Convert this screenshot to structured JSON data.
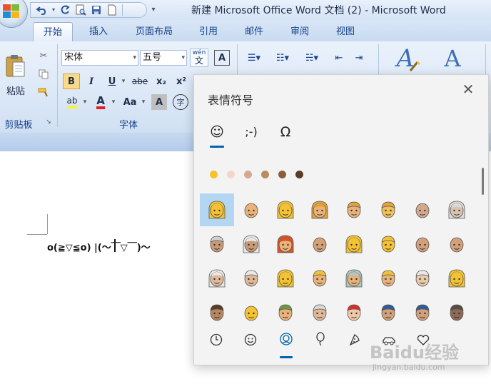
{
  "window": {
    "title": "新建 Microsoft Office Word 文档 (2) - Microsoft Word"
  },
  "quick_access": {
    "undo_icon": "undo-icon",
    "redo_icon": "redo-icon",
    "print_preview_icon": "print-preview-icon",
    "save_icon": "save-icon",
    "new_icon": "new-document-icon",
    "customize_glyph": "▾"
  },
  "tabs": [
    {
      "label": "开始",
      "active": true
    },
    {
      "label": "插入"
    },
    {
      "label": "页面布局"
    },
    {
      "label": "引用"
    },
    {
      "label": "邮件"
    },
    {
      "label": "审阅"
    },
    {
      "label": "视图"
    }
  ],
  "ribbon": {
    "clipboard": {
      "paste_label": "粘贴",
      "group_label": "剪贴板"
    },
    "font": {
      "font_name": "宋体",
      "font_size": "五号",
      "wen_glyph": "wén",
      "wen_char": "文",
      "char_border_glyph": "A",
      "bold": "B",
      "italic": "I",
      "underline": "U",
      "strike": "abe",
      "subscript": "x₂",
      "superscript": "x²",
      "highlight_glyph": "ab",
      "font_color_glyph": "A",
      "change_case": "Aa",
      "char_shading_glyph": "A",
      "enclose_glyph": "字",
      "group_label": "字体"
    },
    "styles": {
      "style_glyph_1": "A",
      "style_glyph_2": "A"
    }
  },
  "document": {
    "text": "o(≧▽≦o) |(～￣▽￣)～"
  },
  "emoji_panel": {
    "title": "表情符号",
    "close_glyph": "✕",
    "categories": [
      {
        "glyph": "☺",
        "name": "emoji"
      },
      {
        "glyph": ";-)",
        "name": "kaomoji"
      },
      {
        "glyph": "Ω",
        "name": "symbols"
      }
    ],
    "skin_tones": [
      "#f5c233",
      "#f2d7c9",
      "#d2a98d",
      "#b98c64",
      "#8d5d3b",
      "#5a3b27"
    ],
    "grid": [
      [
        "blond-woman",
        "man-light",
        "woman",
        "woman-curly",
        "man-blond",
        "man",
        "baby-bald",
        "old-woman"
      ],
      [
        "old-man",
        "old-woman-2",
        "red-hair-woman",
        "man-2",
        "woman-2",
        "boy",
        "man-3",
        "man-4"
      ],
      [
        "white-hair-woman",
        "old-man-2",
        "woman-blond-long",
        "man-blond-2",
        "woman-grey",
        "man-blond-3",
        "old-man-3",
        "old-woman-3"
      ],
      [
        "boy-cap",
        "man-beard",
        "man-green-cap",
        "old-man-santa",
        "santa-claus",
        "police-officer",
        "police-officer-2",
        "detective"
      ]
    ],
    "bottom_categories": [
      "clock-icon",
      "smiley-icon",
      "person-icon",
      "balloon-icon",
      "pizza-icon",
      "car-icon",
      "heart-icon"
    ],
    "selected_bottom": 2
  },
  "watermark": {
    "brand": "Baidu经验",
    "url": "jingyan.baidu.com"
  }
}
